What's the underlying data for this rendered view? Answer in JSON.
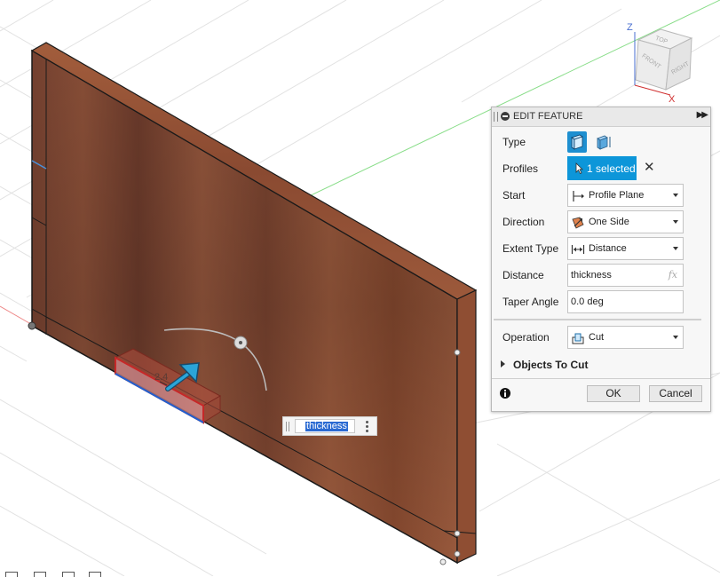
{
  "viewcube": {
    "axis_z": "Z",
    "axis_x": "X",
    "faces": {
      "top": "TOP",
      "front": "FRONT",
      "right": "RIGHT"
    }
  },
  "canvas": {
    "dimension_label": "2.4"
  },
  "panel": {
    "title": "EDIT FEATURE",
    "rows": {
      "type": {
        "label": "Type"
      },
      "profiles": {
        "label": "Profiles",
        "selection": "1 selected"
      },
      "start": {
        "label": "Start",
        "value": "Profile Plane",
        "icon": "profile-plane-icon"
      },
      "direction": {
        "label": "Direction",
        "value": "One Side",
        "icon": "one-side-icon"
      },
      "extent_type": {
        "label": "Extent Type",
        "value": "Distance",
        "icon": "distance-icon"
      },
      "distance": {
        "label": "Distance",
        "value": "thickness",
        "fx": "fx"
      },
      "taper_angle": {
        "label": "Taper Angle",
        "value": "0.0 deg"
      },
      "operation": {
        "label": "Operation",
        "value": "Cut",
        "icon": "cut-icon"
      }
    },
    "objects_to_cut": "Objects To Cut",
    "ok_label": "OK",
    "cancel_label": "Cancel"
  },
  "inline_input": {
    "value": "thickness"
  },
  "colors": {
    "accent_blue": "#0d96d9",
    "wood": "#8a4a30",
    "cut_red": "#c62828"
  }
}
